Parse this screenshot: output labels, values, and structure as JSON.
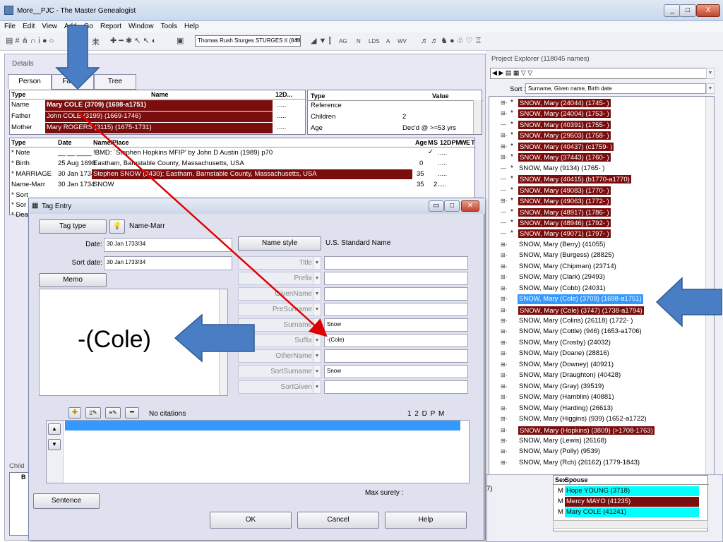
{
  "window": {
    "title": "More__PJC - The Master Genealogist",
    "min": "_",
    "max": "□",
    "close": "X"
  },
  "menu": [
    "File",
    "Edit",
    "View",
    "Add",
    "Go",
    "Report",
    "Window",
    "Tools",
    "Help"
  ],
  "toolbar": {
    "person_select": "Thomas Rush Sturges STURGES II (848",
    "labels": [
      "AG",
      "N",
      "LDS",
      "A",
      "WV"
    ]
  },
  "details": {
    "title": "Details",
    "tabs": [
      "Person",
      "Family",
      "Tree"
    ],
    "top_grid": {
      "headers": [
        "Type",
        "Name",
        "12D..."
      ],
      "rows": [
        {
          "type": "Name",
          "name": "Mary COLE (3709)  (1698-a1751)",
          "dots": "....."
        },
        {
          "type": "Father",
          "name": "John COLE (3199)  (1669-1746)",
          "dots": "....."
        },
        {
          "type": "Mother",
          "name": "Mary ROGERS (3115)  (1675-1731)",
          "dots": "....."
        }
      ]
    },
    "value_grid": {
      "headers": [
        "Type",
        "Value"
      ],
      "rows": [
        {
          "type": "Reference",
          "value": ""
        },
        {
          "type": "Children",
          "value": "2"
        },
        {
          "type": "Age",
          "value": "Dec'd @ >=53 yrs"
        }
      ]
    },
    "events": {
      "headers": [
        "Type",
        "Date",
        "Name/Place",
        "Age",
        "M",
        "S",
        "12DPM",
        "W",
        "E",
        "T"
      ],
      "rows": [
        {
          "type": "* Note",
          "date": "__ __ ____",
          "place": "!BMD: `Stephen Hopkins MFIP' by John D Austin (1989) p70",
          "age": "",
          "ms": "✓",
          "dots": "....."
        },
        {
          "type": "* Birth",
          "date": "25 Aug 1698",
          "place": "Eastham, Barnstable County, Massachusetts, USA",
          "age": "0",
          "ms": "",
          "dots": "....."
        },
        {
          "type": "* MARRIAGE",
          "date": "30 Jan 1734",
          "place": "Stephen SNOW (3430); Eastham, Barnstable County, Massachusetts, USA",
          "age": "35",
          "ms": "",
          "dots": "....."
        },
        {
          "type": "Name-Marr",
          "date": "30 Jan 1734",
          "place": "SNOW",
          "age": "35",
          "ms": "",
          "dots": "2....."
        },
        {
          "type": "* Sort",
          "date": "",
          "place": "",
          "age": "",
          "ms": "",
          "dots": ""
        },
        {
          "type": "* Sor",
          "date": "",
          "place": "",
          "age": "",
          "ms": "",
          "dots": ""
        },
        {
          "type": "* Dea",
          "date": "",
          "place": "",
          "age": "",
          "ms": "",
          "dots": ""
        }
      ]
    },
    "children_label": "Child",
    "children_col_b": "B"
  },
  "tag_entry": {
    "title": "Tag Entry",
    "tag_type_button": "Tag type",
    "tag_type_value": "Name-Marr",
    "date_label": "Date:",
    "date_value": "30 Jan 1733/34",
    "sort_date_label": "Sort date:",
    "sort_date_value": "30 Jan 1733/34",
    "memo_button": "Memo",
    "name_style_button": "Name style",
    "name_style_value": "U.S. Standard Name",
    "fields": [
      {
        "label": "Title",
        "value": ""
      },
      {
        "label": "Prefix",
        "value": ""
      },
      {
        "label": "GivenName",
        "value": ""
      },
      {
        "label": "PreSurname",
        "value": ""
      },
      {
        "label": "Surname",
        "value": "Snow"
      },
      {
        "label": "Suffix",
        "value": "-(Cole)"
      },
      {
        "label": "OtherName",
        "value": ""
      },
      {
        "label": "SortSurname",
        "value": "Snow"
      },
      {
        "label": "SortGiven",
        "value": ""
      }
    ],
    "citations_text": "No citations",
    "citation_cols": "1  2  D  P  M",
    "max_surety": "Max surety :",
    "sentence_button": "Sentence",
    "ok_button": "OK",
    "cancel_button": "Cancel",
    "help_button": "Help"
  },
  "annotation": {
    "cole_label": "-(Cole)",
    "arrow_color": "#4a7ec4",
    "red_line": "#e00000"
  },
  "explorer": {
    "title": "Project Explorer (118045 names)",
    "sort_label": "Sort :",
    "sort_value": "Surname, Given name, Birth date",
    "items": [
      {
        "text": "SNOW, Mary (24044) (1745-  )",
        "star": true,
        "maroon": true,
        "exp": "⊞-"
      },
      {
        "text": "SNOW, Mary (24004) (1753-  )",
        "star": true,
        "maroon": true,
        "exp": "⊞-"
      },
      {
        "text": "SNOW, Mary (40391) (1755-  )",
        "star": true,
        "maroon": true,
        "exp": "—"
      },
      {
        "text": "SNOW, Mary (29503) (1758-  )",
        "star": true,
        "maroon": true,
        "exp": "⊞-"
      },
      {
        "text": "SNOW, Mary (40437) (c1759-  )",
        "star": true,
        "maroon": true,
        "exp": "⊞-"
      },
      {
        "text": "SNOW, Mary (37443) (1760-  )",
        "star": true,
        "maroon": true,
        "exp": "⊞-"
      },
      {
        "text": "SNOW, Mary (9134) (1765-  )",
        "star": true,
        "maroon": false,
        "exp": "—"
      },
      {
        "text": "SNOW, Mary (40415) (b1770-a1770)",
        "star": true,
        "maroon": true,
        "exp": "—"
      },
      {
        "text": "SNOW, Mary (49083) (1770-  )",
        "star": true,
        "maroon": true,
        "exp": "—"
      },
      {
        "text": "SNOW, Mary (49063) (1772-  )",
        "star": true,
        "maroon": true,
        "exp": "⊞-"
      },
      {
        "text": "SNOW, Mary (48917) (1786-  )",
        "star": true,
        "maroon": true,
        "exp": "—"
      },
      {
        "text": "SNOW, Mary (48946) (1792-  )",
        "star": true,
        "maroon": true,
        "exp": "—"
      },
      {
        "text": "SNOW, Mary (49071) (1797-  )",
        "star": true,
        "maroon": true,
        "exp": "—"
      },
      {
        "text": "SNOW, Mary (Berry) (41055)",
        "star": false,
        "maroon": false,
        "exp": "⊞-"
      },
      {
        "text": "SNOW, Mary (Burgess) (28825)",
        "star": false,
        "maroon": false,
        "exp": "⊞-"
      },
      {
        "text": "SNOW, Mary (Chipman) (23714)",
        "star": false,
        "maroon": false,
        "exp": "⊞-"
      },
      {
        "text": "SNOW, Mary (Clark) (29493)",
        "star": false,
        "maroon": false,
        "exp": "⊞-"
      },
      {
        "text": "SNOW, Mary (Cobb) (24031)",
        "star": false,
        "maroon": false,
        "exp": "⊞-"
      },
      {
        "text": "SNOW, Mary (Cole) (3709) (1698-a1751)",
        "star": false,
        "maroon": false,
        "sel": true,
        "exp": "⊞-"
      },
      {
        "text": "SNOW, Mary (Cole) (3747) (1738-a1794)",
        "star": false,
        "maroon": true,
        "exp": "⊞-"
      },
      {
        "text": "SNOW, Mary (Colins) (26118) (1722-  )",
        "star": false,
        "maroon": false,
        "exp": "⊞-"
      },
      {
        "text": "SNOW, Mary (Cottle) (946) (1653-a1706)",
        "star": false,
        "maroon": false,
        "exp": "⊞-"
      },
      {
        "text": "SNOW, Mary (Crosby) (24032)",
        "star": false,
        "maroon": false,
        "exp": "⊞-"
      },
      {
        "text": "SNOW, Mary (Doane) (28816)",
        "star": false,
        "maroon": false,
        "exp": "⊞-"
      },
      {
        "text": "SNOW, Mary (Downey) (40921)",
        "star": false,
        "maroon": false,
        "exp": "⊞-"
      },
      {
        "text": "SNOW, Mary (Draughton) (40428)",
        "star": false,
        "maroon": false,
        "exp": "⊞-"
      },
      {
        "text": "SNOW, Mary (Gray) (39519)",
        "star": false,
        "maroon": false,
        "exp": "⊞-"
      },
      {
        "text": "SNOW, Mary (Hamblin) (40881)",
        "star": false,
        "maroon": false,
        "exp": "⊞-"
      },
      {
        "text": "SNOW, Mary (Harding) (26613)",
        "star": false,
        "maroon": false,
        "exp": "⊞-"
      },
      {
        "text": "SNOW, Mary (Higgins) (939) (1652-a1722)",
        "star": false,
        "maroon": false,
        "exp": "⊞-"
      },
      {
        "text": "SNOW, Mary (Hopkins) (3809) (>1708-1763)",
        "star": false,
        "maroon": true,
        "exp": "⊞-"
      },
      {
        "text": "SNOW, Mary (Lewis) (26168)",
        "star": false,
        "maroon": false,
        "exp": "⊞-"
      },
      {
        "text": "SNOW, Mary (Polly) (9539)",
        "star": false,
        "maroon": false,
        "exp": "⊞-"
      },
      {
        "text": "SNOW, Mary (Rch) (26162) (1779-1843)",
        "star": false,
        "maroon": false,
        "exp": "⊞-"
      }
    ]
  },
  "spouse": {
    "headers": [
      "Sex",
      "Spouse"
    ],
    "left_partial": "7)",
    "rows": [
      {
        "sex": "M",
        "name": "Hope YOUNG (3718)",
        "color": "#00ffff"
      },
      {
        "sex": "M",
        "name": "Mercy MAYO (41235)",
        "color": "#7a0d0d"
      },
      {
        "sex": "M",
        "name": "Mary COLE (41241)",
        "color": "#00ffff"
      }
    ]
  }
}
